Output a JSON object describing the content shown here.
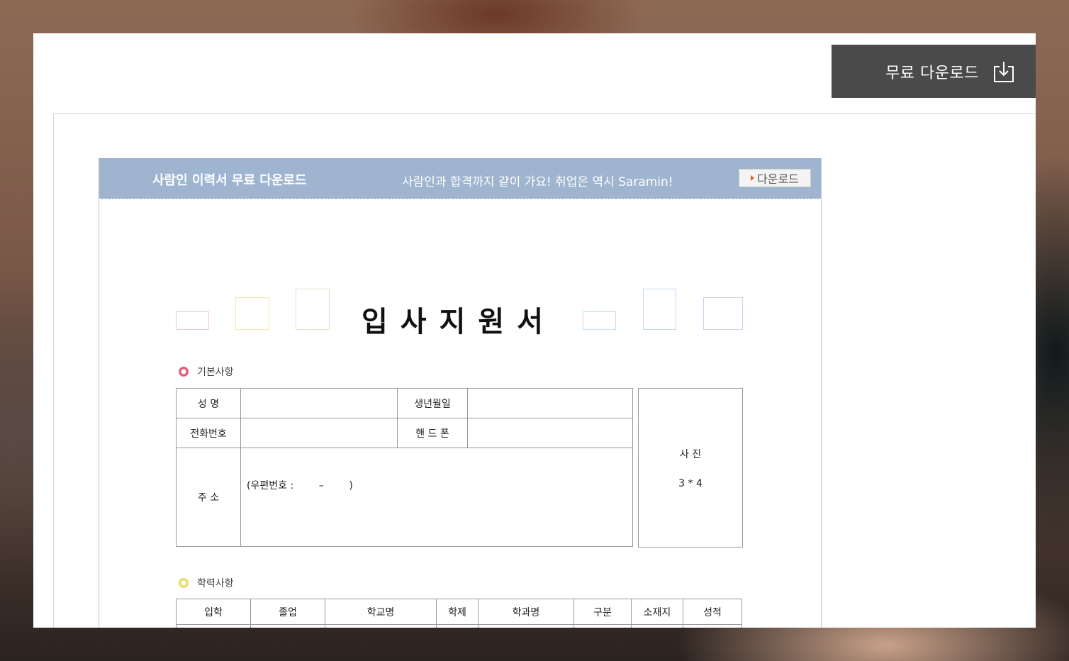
{
  "download_button": {
    "label": "무료 다운로드",
    "icon": "download-icon"
  },
  "banner": {
    "title": "사람인 이력서 무료 다운로드",
    "tagline": "사람인과 합격까지 같이 가요! 취업은 역시 Saramin!",
    "button_label": "다운로드"
  },
  "form": {
    "title": "입사지원서",
    "basic_section": {
      "label": "기본사항",
      "name_label": "성 명",
      "birth_label": "생년월일",
      "phone_label": "전화번호",
      "mobile_label": "핸 드 폰",
      "address_label": "주 소",
      "postal_label": "(우편번호 :        –        )",
      "photo_label": "사 진",
      "photo_size": "3 * 4"
    },
    "education_section": {
      "label": "학력사항",
      "headers": [
        "입학",
        "졸업",
        "학교명",
        "학제",
        "학과명",
        "구분",
        "소재지",
        "성적"
      ]
    }
  },
  "colors": {
    "banner_bg": "#9fb4cf",
    "button_bg": "#4a4a4a",
    "basic_dot": "#e0607a",
    "education_dot": "#e8dc6a"
  }
}
